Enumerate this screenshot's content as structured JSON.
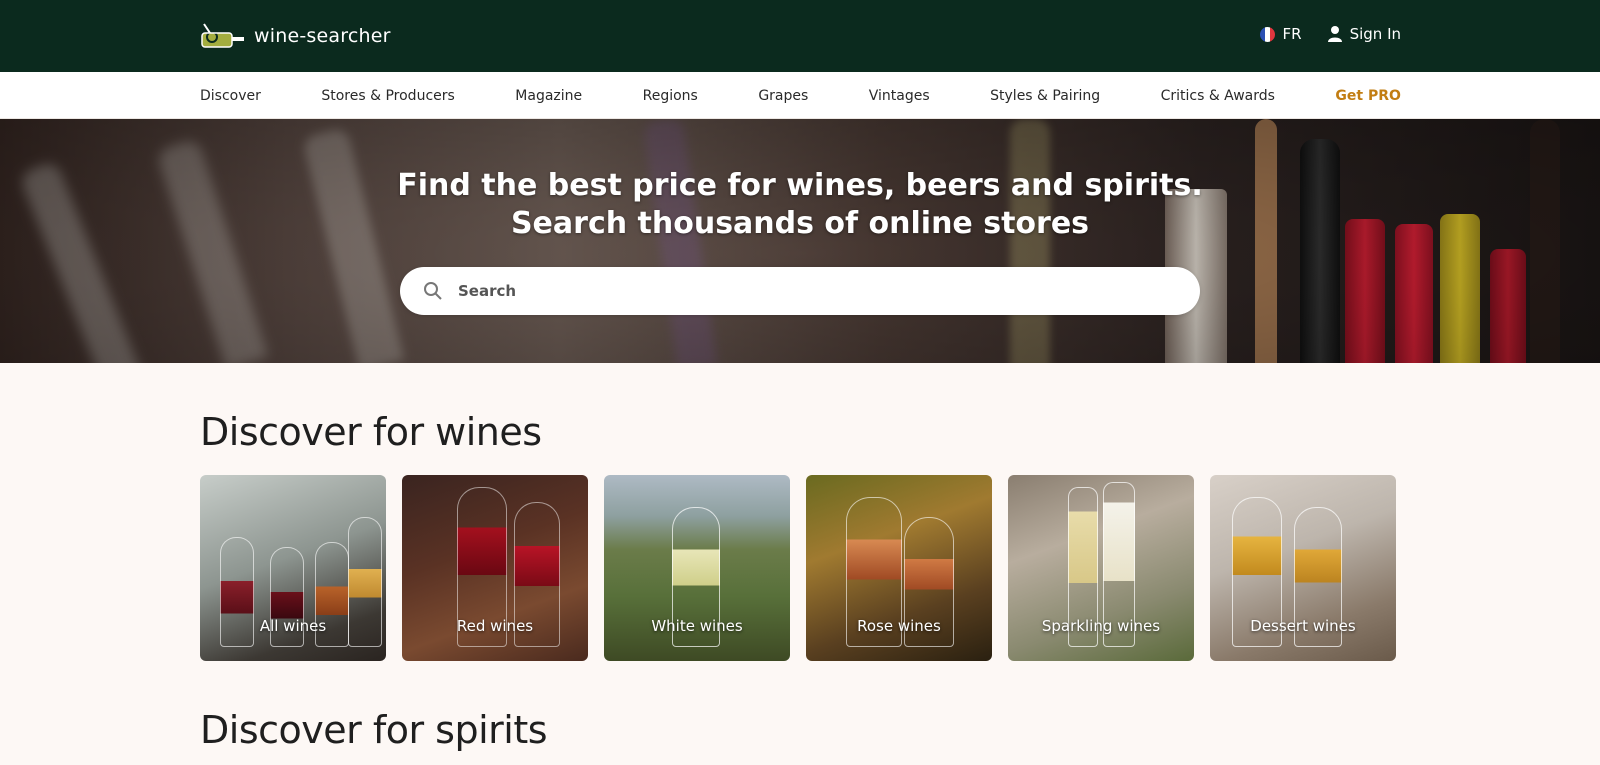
{
  "header": {
    "logo_text": "wine-searcher",
    "language": "FR",
    "sign_in": "Sign In"
  },
  "nav": {
    "items": [
      "Discover",
      "Stores & Producers",
      "Magazine",
      "Regions",
      "Grapes",
      "Vintages",
      "Styles & Pairing",
      "Critics & Awards"
    ],
    "pro_label": "Get PRO",
    "pro_color": "#c27d12"
  },
  "hero": {
    "title_line1": "Find the best price for wines, beers and spirits.",
    "title_line2": "Search thousands of online stores",
    "search_placeholder": "Search"
  },
  "discover_wines": {
    "title": "Discover for wines",
    "cards": [
      "All wines",
      "Red wines",
      "White wines",
      "Rose wines",
      "Sparkling wines",
      "Dessert wines"
    ]
  },
  "discover_spirits": {
    "title": "Discover for spirits"
  },
  "colors": {
    "header_bg": "#0b2a1e",
    "page_bg": "#fdf8f5",
    "accent": "#c27d12"
  },
  "icons": [
    "wine-bottle-logo-icon",
    "france-flag-icon",
    "user-icon",
    "search-icon"
  ]
}
